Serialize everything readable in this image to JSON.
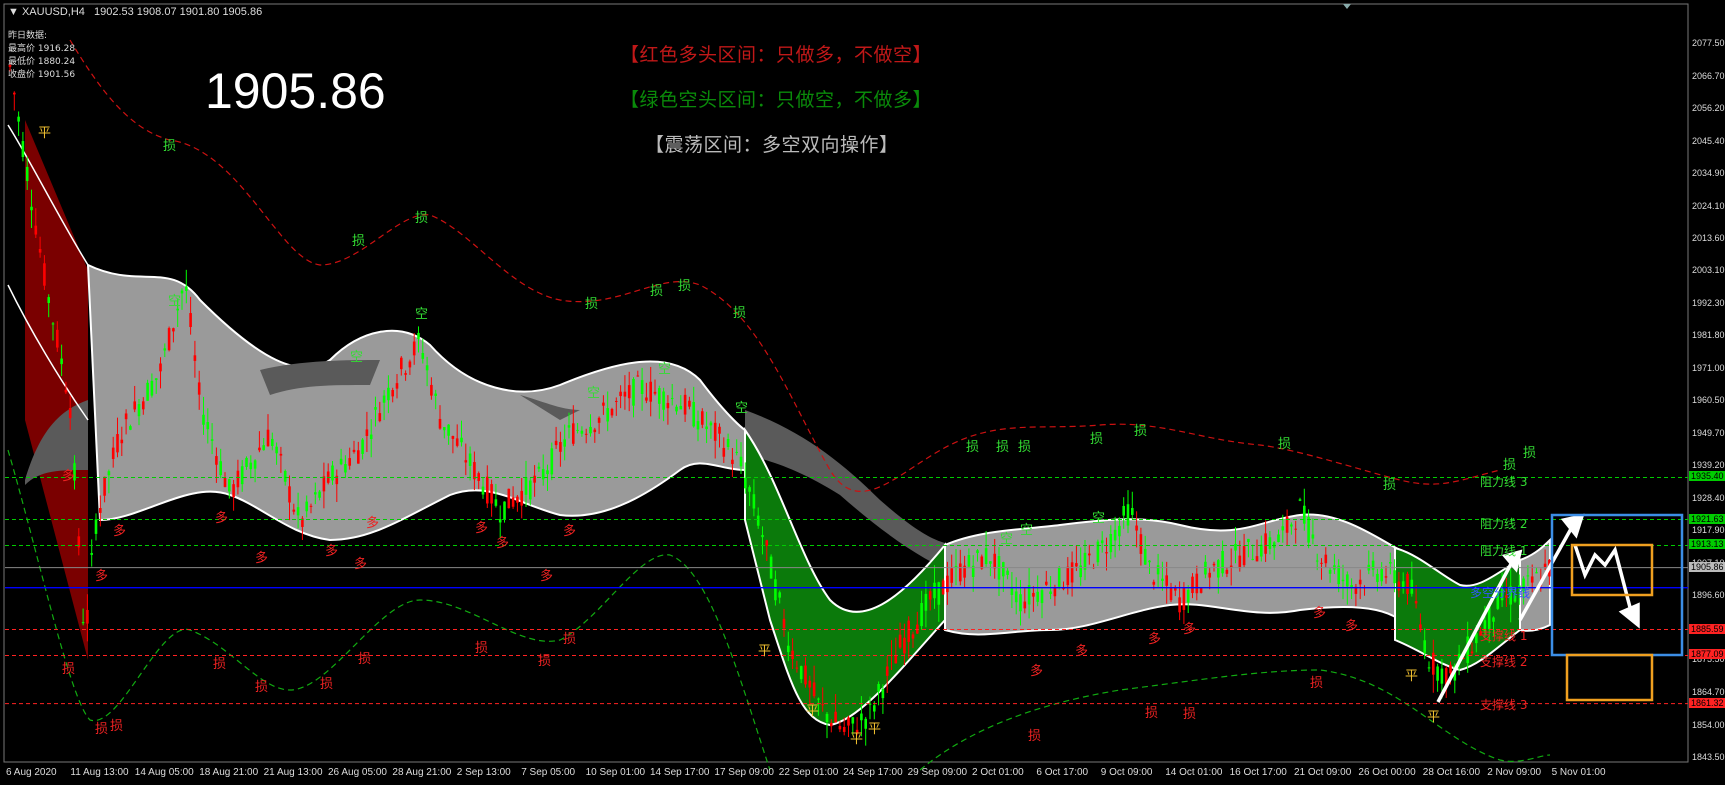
{
  "header": {
    "symbol": "XAUUSD,H4",
    "ohlc": "1902.53 1908.07 1901.80 1905.86"
  },
  "info_panel": {
    "title": "昨日数据:",
    "lines": [
      "最高价 1916.28",
      "最低价 1880.24",
      "收盘价 1901.56"
    ]
  },
  "big_price": "1905.86",
  "messages": {
    "red": "【红色多头区间：只做多，不做空】",
    "green": "【绿色空头区间：只做空，不做多】",
    "gray": "【震荡区间：多空双向操作】"
  },
  "colors": {
    "background": "#000000",
    "bull_candle": "#ff0000",
    "bear_candle": "#00ff00",
    "band_gray": "#9a9a9a",
    "band_green": "#0b7a0b",
    "band_red": "#7a0000",
    "pivot_blue": "#0000ff",
    "box_blue": "#3c8ee6",
    "box_orange": "#f0a020"
  },
  "price_axis": [
    "2077.50",
    "2066.70",
    "2056.20",
    "2045.40",
    "2034.90",
    "2024.10",
    "2013.60",
    "2003.10",
    "1992.30",
    "1981.80",
    "1971.00",
    "1960.50",
    "1949.70",
    "1939.20",
    "1928.40",
    "1917.90",
    "1907.10",
    "1896.60",
    "1875.50",
    "1864.70",
    "1854.00",
    "1843.50"
  ],
  "price_tags": [
    {
      "text": "1935.40",
      "color": "#00cc00",
      "y": 1935.4
    },
    {
      "text": "1921.63",
      "color": "#00cc00",
      "y": 1921.63
    },
    {
      "text": "1913.13",
      "color": "#00cc00",
      "y": 1913.13
    },
    {
      "text": "1905.86",
      "color": "#bbbbbb",
      "y": 1905.86
    },
    {
      "text": "1885.59",
      "color": "#ff2222",
      "y": 1885.59
    },
    {
      "text": "1877.09",
      "color": "#ff2222",
      "y": 1877.09
    },
    {
      "text": "1861.32",
      "color": "#ff2222",
      "y": 1861.32
    }
  ],
  "time_axis": [
    "6 Aug 2020",
    "11 Aug 13:00",
    "14 Aug 05:00",
    "18 Aug 21:00",
    "21 Aug 13:00",
    "26 Aug 05:00",
    "28 Aug 21:00",
    "2 Sep 13:00",
    "7 Sep 05:00",
    "10 Sep 01:00",
    "14 Sep 17:00",
    "17 Sep 09:00",
    "22 Sep 01:00",
    "24 Sep 17:00",
    "29 Sep 09:00",
    "2 Oct 01:00",
    "6 Oct 17:00",
    "9 Oct 09:00",
    "14 Oct 01:00",
    "16 Oct 17:00",
    "21 Oct 09:00",
    "26 Oct 00:00",
    "28 Oct 16:00",
    "2 Nov 09:00",
    "5 Nov 01:00"
  ],
  "levels": {
    "res3": "阻力线 3",
    "res2": "阻力线 2",
    "res1": "阻力线 1",
    "pivot": "多空分界线",
    "sup1": "支撑线 1",
    "sup2": "支撑线 2",
    "sup3": "支撑线 3"
  },
  "mark_labels": {
    "stop": "损",
    "close": "平",
    "long": "多",
    "short": "空"
  },
  "chart_data": {
    "type": "candlestick",
    "y_range": [
      1843.5,
      2082
    ],
    "x_range": [
      0,
      1690
    ],
    "horizontal_lines": [
      {
        "name": "res3",
        "value": 1935.4,
        "style": "dashed",
        "color": "#00cc00"
      },
      {
        "name": "res2",
        "value": 1921.63,
        "style": "dashed",
        "color": "#00cc00"
      },
      {
        "name": "res1",
        "value": 1913.13,
        "style": "dashed",
        "color": "#00cc00"
      },
      {
        "name": "current",
        "value": 1905.86,
        "style": "solid",
        "color": "#888888"
      },
      {
        "name": "pivot",
        "value": 1899.3,
        "style": "solid",
        "color": "#0000ff"
      },
      {
        "name": "sup1",
        "value": 1885.59,
        "style": "dashed",
        "color": "#ff2222"
      },
      {
        "name": "sup2",
        "value": 1877.09,
        "style": "dashed",
        "color": "#ff2222"
      },
      {
        "name": "sup3",
        "value": 1861.32,
        "style": "dashed",
        "color": "#ff2222"
      }
    ]
  }
}
